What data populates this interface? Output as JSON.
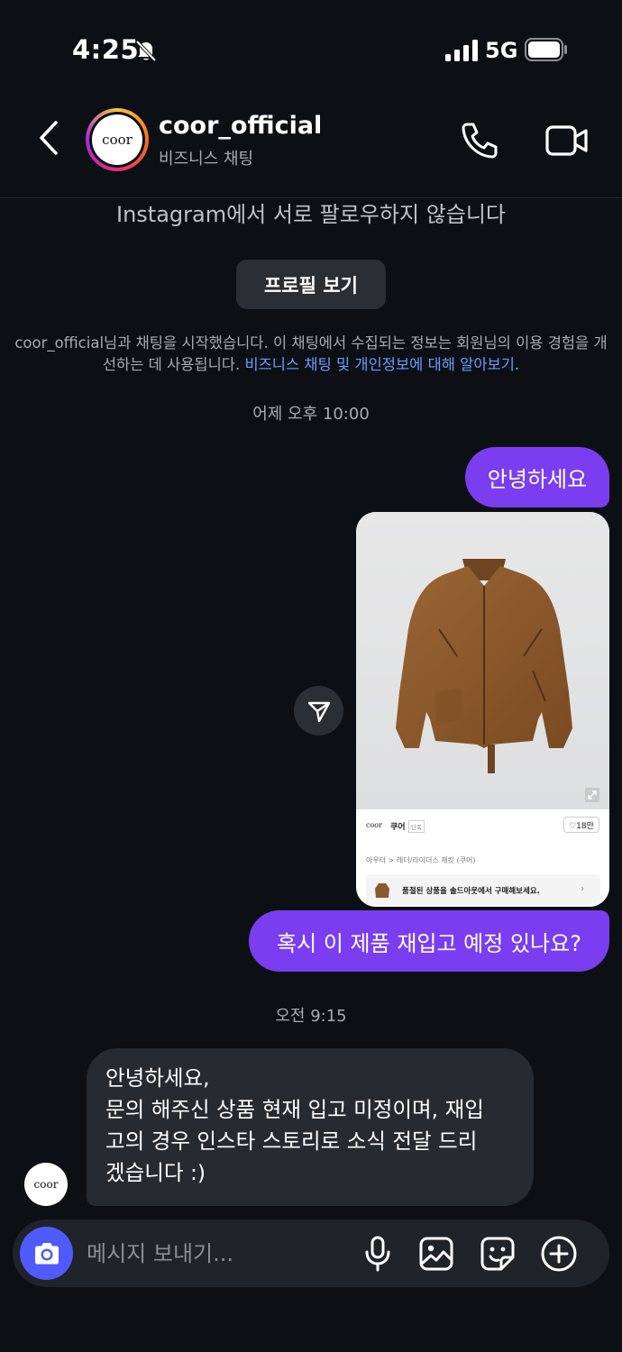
{
  "status_bar": {
    "time": "4:25",
    "network": "5G",
    "icons": [
      "bell-slash-icon",
      "signal-icon",
      "battery-icon"
    ]
  },
  "header": {
    "back_icon": "chevron-left-icon",
    "avatar_text": "coor",
    "name": "coor_official",
    "subtitle": "비즈니스 채팅",
    "call_icon": "phone-icon",
    "video_icon": "video-camera-icon"
  },
  "notice": {
    "text": "Instagram에서 서로 팔로우하지 않습니다",
    "profile_button": "프로필 보기"
  },
  "info": {
    "text": "coor_official님과 채팅을 시작했습니다. 이 채팅에서 수집되는 정보는 회원님의 이용 경험을 개선하는 데 사용됩니다. ",
    "link": "비즈니스 채팅 및 개인정보에 대해 알아보기",
    "suffix": "."
  },
  "timestamps": {
    "first": "어제 오후 10:00",
    "second": "오전 9:15"
  },
  "messages": {
    "out_1": "안녕하세요",
    "out_2": "혹시 이 제품 재입고 예정 있나요?",
    "in_1": {
      "lines": [
        "안녕하세요,",
        "문의 해주신 상품 현재 입고 미정이며, 재입",
        "고의 경우 인스타 스토리로 소식 전달 드리",
        "겠습니다 :)"
      ]
    },
    "sender_avatar": "coor"
  },
  "product_card": {
    "brand_logo": "coor",
    "brand_name": "쿠어",
    "brand_badge": "단독",
    "likes": "♡18만",
    "breadcrumb": "아우터 > 레더/라이더스 재킷 (쿠어)",
    "promo": "품절된 상품을 솔드아웃에서 구매해보세요.",
    "promo_chevron": "›",
    "product_color": "#8a5a2e"
  },
  "composer": {
    "placeholder": "메시지 보내기...",
    "icons": [
      "camera-icon",
      "microphone-icon",
      "gallery-icon",
      "sticker-icon",
      "plus-circle-icon"
    ],
    "accent": "#4f5bff"
  },
  "colors": {
    "background": "#0c0f14",
    "outgoing_bubble": "#7b3df0",
    "incoming_bubble": "#262a31",
    "link": "#6b9dff"
  }
}
